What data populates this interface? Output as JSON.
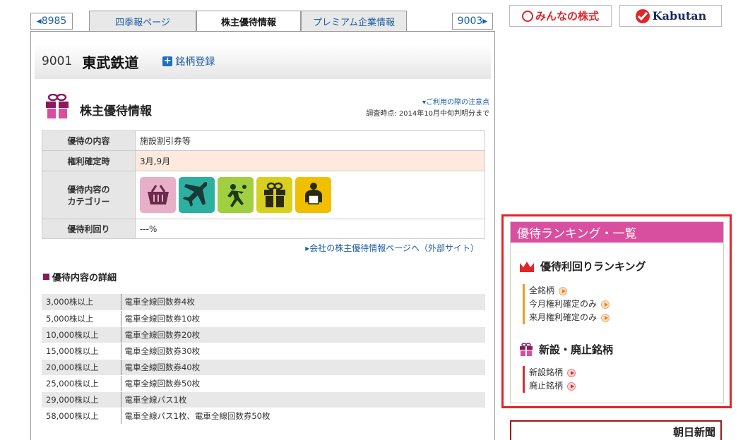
{
  "tabs": {
    "prev": "◂8985",
    "quarterly": "四季報ページ",
    "yutai": "株主優待情報",
    "premium": "プレミアム企業情報",
    "next": "9003▸"
  },
  "stock": {
    "code": "9001",
    "name": "東武鉄道",
    "register_label": "銘柄登録"
  },
  "section": {
    "title": "株主優待情報",
    "notice_link": "▾ご利用の際の注意点",
    "survey_date": "調査時点: 2014年10月中旬判明分まで"
  },
  "info": {
    "content_label": "優待の内容",
    "content_value": "施設割引券等",
    "rights_label": "権利確定時",
    "rights_value": "3月,9月",
    "category_label_1": "優待内容の",
    "category_label_2": "カテゴリー",
    "category_icons": [
      "basket-icon",
      "airplane-icon",
      "leisure-icon",
      "gift-icon",
      "donation-icon"
    ],
    "yield_label": "優待利回り",
    "yield_value": "---%"
  },
  "external_link": "▸会社の株主優待情報ページへ（外部サイト）",
  "details": {
    "title": "優待内容の詳細",
    "rows": [
      {
        "shares": "3,000株以上",
        "benefit": "電車全線回数券4枚"
      },
      {
        "shares": "5,000株以上",
        "benefit": "電車全線回数券10枚"
      },
      {
        "shares": "10,000株以上",
        "benefit": "電車全線回数券20枚"
      },
      {
        "shares": "15,000株以上",
        "benefit": "電車全線回数券30枚"
      },
      {
        "shares": "20,000株以上",
        "benefit": "電車全線回数券40枚"
      },
      {
        "shares": "25,000株以上",
        "benefit": "電車全線回数券50枚"
      },
      {
        "shares": "29,000株以上",
        "benefit": "電車全線パス1枚"
      },
      {
        "shares": "58,000株以上",
        "benefit": "電車全線パス1枚、電車全線回数券50枚"
      }
    ]
  },
  "logos": {
    "minkabu": "みんなの株式",
    "kabutan": "Kabutan"
  },
  "ranking": {
    "header": "優待ランキング・一覧",
    "yield_title": "優待利回りランキング",
    "yield_items": [
      "全銘柄",
      "今月権利確定のみ",
      "来月権利確定のみ"
    ],
    "new_title": "新設・廃止銘柄",
    "new_items": [
      "新設銘柄",
      "廃止銘柄"
    ]
  },
  "asahi": "朝日新聞",
  "colors": {
    "accent_pink": "#d94fa0",
    "highlight_red": "#e0262a",
    "link_blue": "#1a5fa0"
  }
}
